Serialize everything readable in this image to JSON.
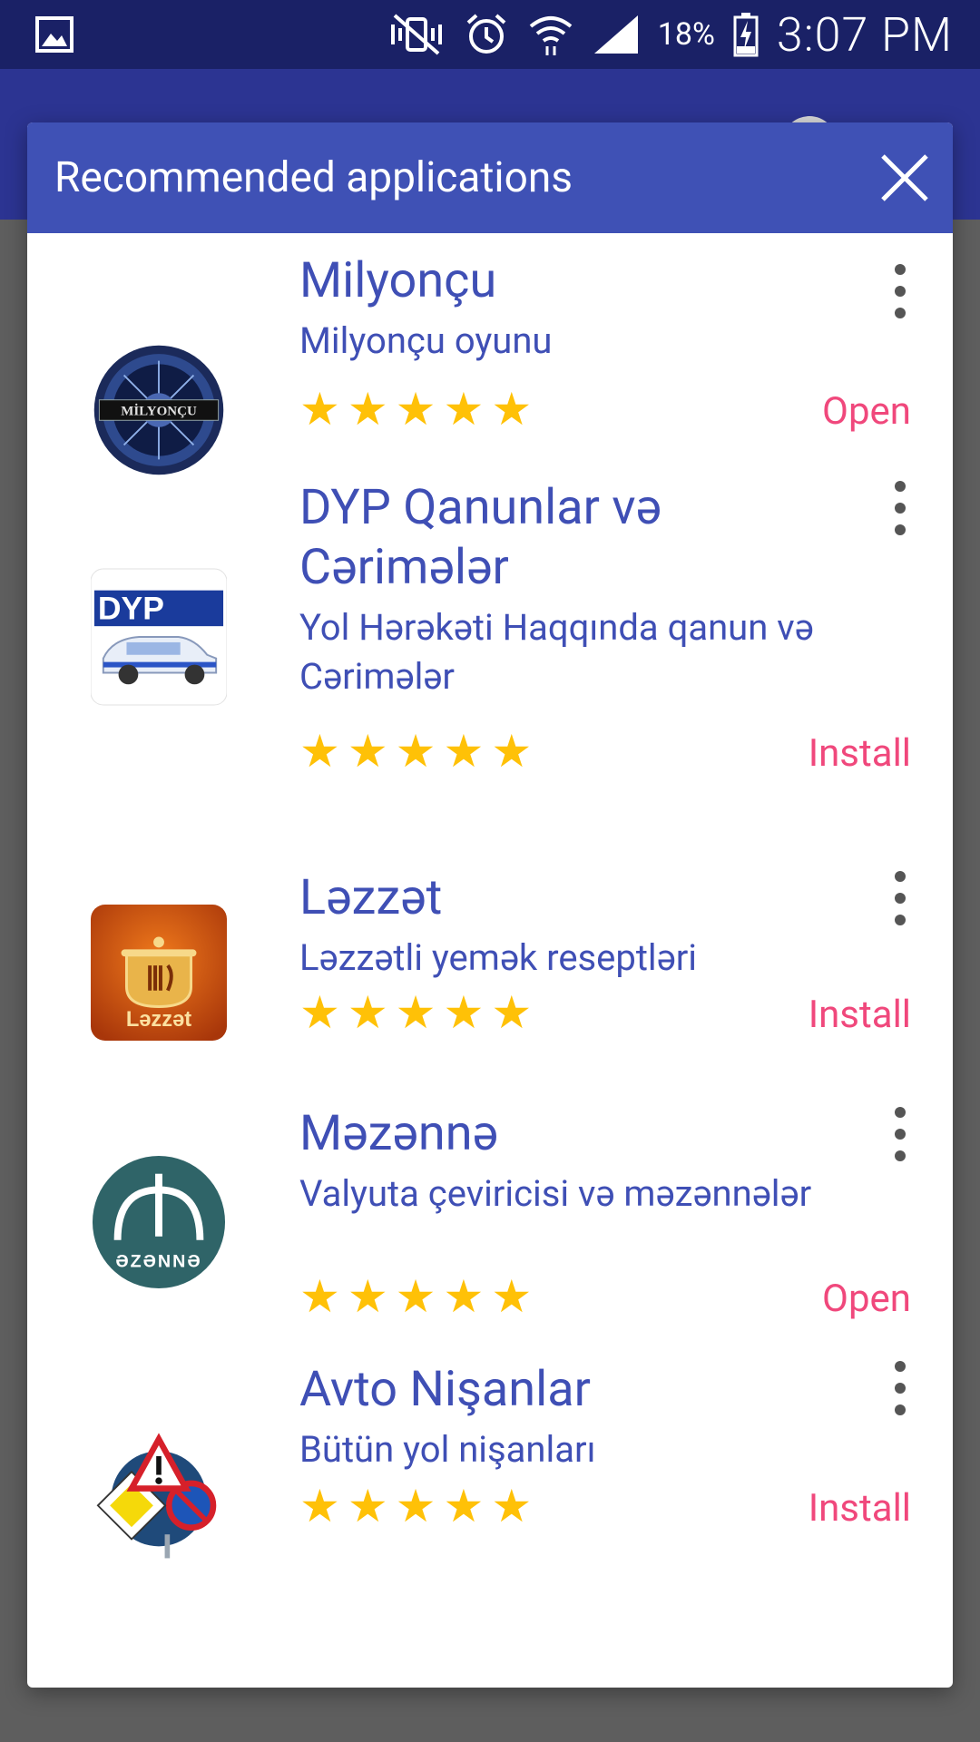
{
  "status_bar": {
    "battery_percent": "18%",
    "time": "3:07 PM"
  },
  "dialog": {
    "title": "Recommended applications",
    "apps": [
      {
        "name": "Milyonçu",
        "description": "Milyonçu oyunu",
        "rating": 5,
        "action": "Open",
        "icon": "milyoncu-logo-icon",
        "icon_text": "MİLYONÇU"
      },
      {
        "name": "DYP Qanunlar və Cərimələr",
        "description": "Yol Hərəkəti Haqqında qanun və Cərimələr",
        "rating": 5,
        "action": "Install",
        "icon": "dyp-police-car-icon",
        "icon_text": "DYP"
      },
      {
        "name": "Ləzzət",
        "description": "Ləzzətli yemək reseptləri",
        "rating": 5,
        "action": "Install",
        "icon": "lezzet-cooking-pot-icon",
        "icon_text": "Ləzzət"
      },
      {
        "name": "Məzənnə",
        "description": "Valyuta çeviricisi və məzənnələr",
        "rating": 5,
        "action": "Open",
        "icon": "mezenne-manat-icon",
        "icon_text": "ƏZƏNNƏ"
      },
      {
        "name": "Avto Nişanlar",
        "description": "Bütün yol nişanları",
        "rating": 5,
        "action": "Install",
        "icon": "road-signs-icon",
        "icon_text": ""
      }
    ]
  },
  "colors": {
    "header": "#3f51b5",
    "status_bar": "#1a2166",
    "text_accent": "#3f4fb5",
    "action": "#f0487c",
    "star": "#ffc107"
  }
}
